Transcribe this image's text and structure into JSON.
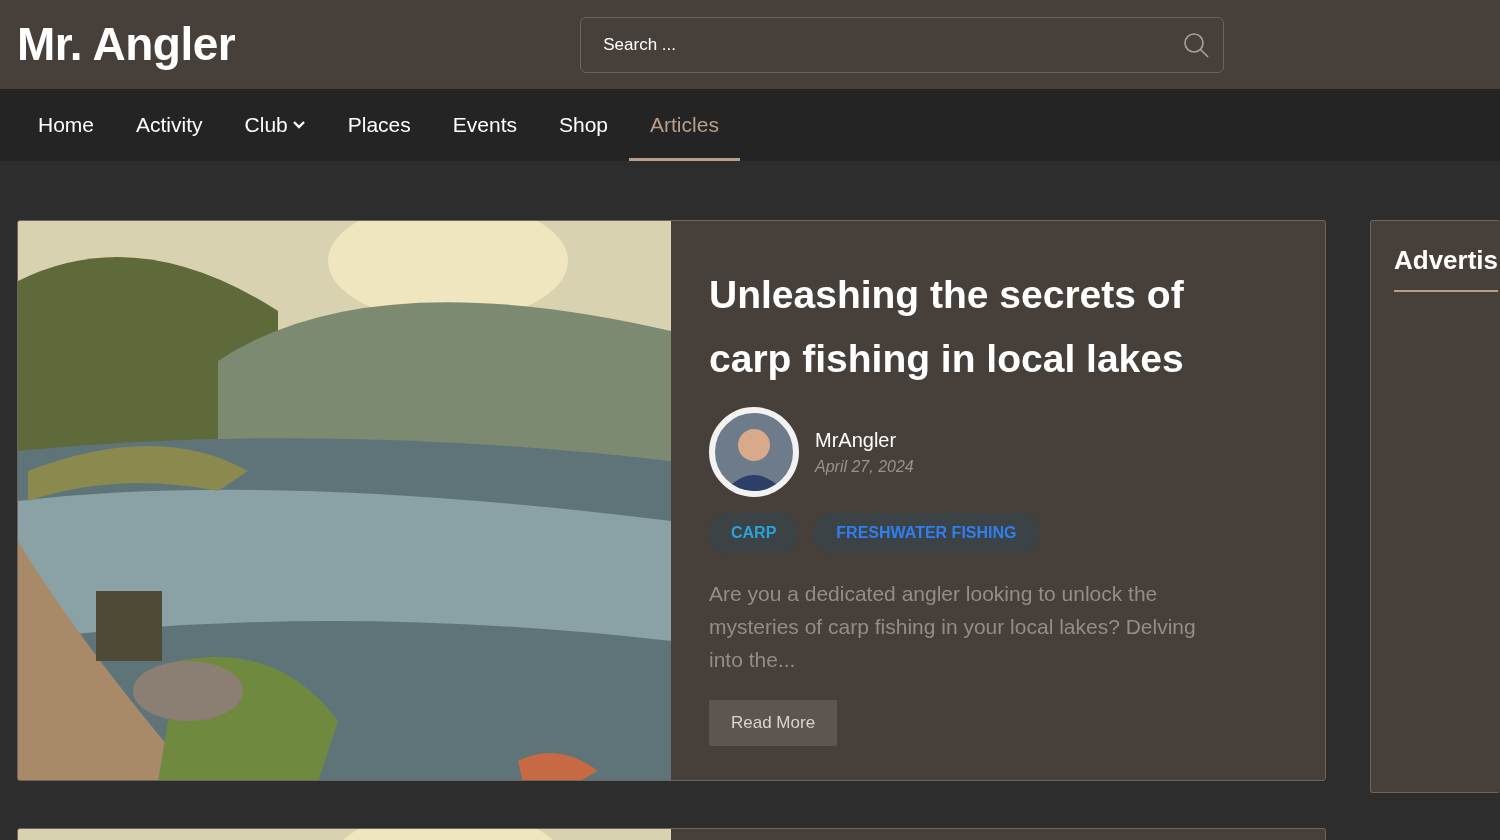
{
  "site": {
    "logo": "Mr. Angler",
    "search": {
      "placeholder": "Search ..."
    }
  },
  "nav": [
    {
      "label": "Home",
      "selected": false,
      "has_dropdown": false
    },
    {
      "label": "Activity",
      "selected": false,
      "has_dropdown": false
    },
    {
      "label": "Club",
      "selected": false,
      "has_dropdown": true
    },
    {
      "label": "Places",
      "selected": false,
      "has_dropdown": false
    },
    {
      "label": "Events",
      "selected": false,
      "has_dropdown": false
    },
    {
      "label": "Shop",
      "selected": false,
      "has_dropdown": false
    },
    {
      "label": "Articles",
      "selected": true,
      "has_dropdown": false
    }
  ],
  "articles": [
    {
      "image": {
        "kind": "picture"
      },
      "title": "Unleashing the secrets of carp fishing in local lakes",
      "author": "MrAngler",
      "date": "April 27, 2024",
      "tags": [
        {
          "label": "CARP",
          "color": "#2aa3db"
        },
        {
          "label": "FRESHWATER FISHING",
          "color": "#2f7ff0"
        }
      ],
      "excerpt": "Are you a dedicated angler looking to unlock the mysteries of carp fishing in your local lakes? Delving into the...",
      "button": "Read More"
    },
    {
      "image": {
        "kind": "picture"
      }
    }
  ],
  "sidebar": {
    "title": "Advertis"
  }
}
